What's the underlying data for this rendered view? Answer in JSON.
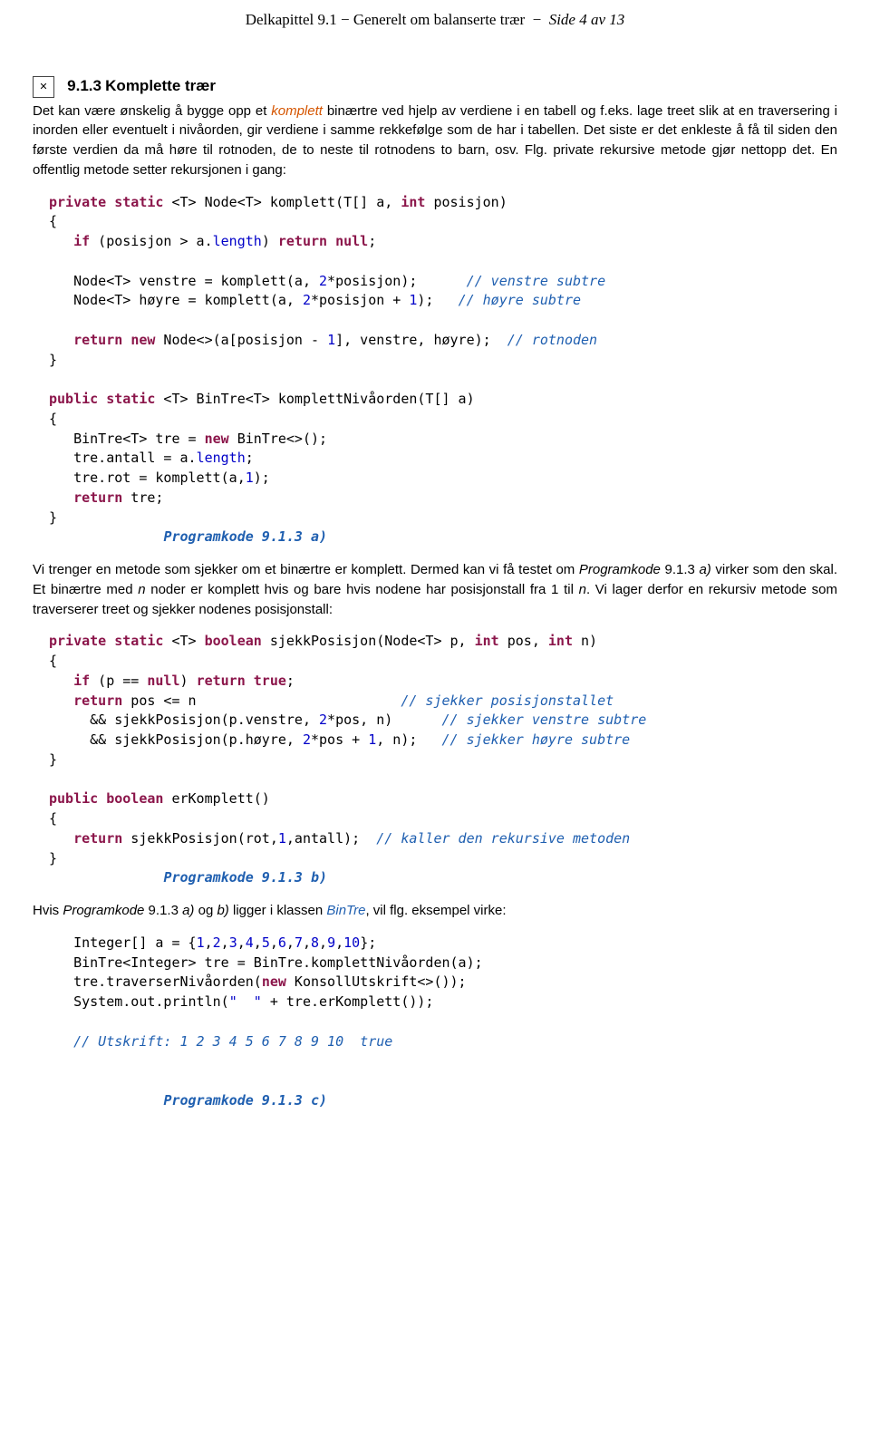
{
  "header": {
    "chapter": "Delkapittel 9.1 − Generelt om balanserte trær",
    "page": "Side 4 av 13"
  },
  "section": {
    "icon": "✕",
    "number": "9.1.3",
    "title": "Komplette trær"
  },
  "intro": {
    "p1a": "Det kan være ønskelig å bygge opp et ",
    "p1_em": "komplett",
    "p1b": " binærtre ved hjelp av verdiene i en tabell og f.eks. lage treet slik at en traversering i inorden eller eventuelt i nivåorden, gir verdiene i samme rekkefølge som de har i tabellen. Det siste er det enkleste å få til siden den første verdien da må høre til rotnoden, de to neste til rotnodens to barn, osv. Flg. private rekursive metode gjør nettopp det. En offentlig metode setter rekursjonen i gang:"
  },
  "code_a": {
    "kw_private": "private",
    "kw_static": "static",
    "kw_int": "int",
    "kw_if": "if",
    "kw_return": "return",
    "kw_null": "null",
    "kw_new": "new",
    "kw_public": "public",
    "sig1_a": " <T> Node<T> komplett(T[] a, ",
    "sig1_b": " posisjon)",
    "brace_open": "{",
    "brace_close": "}",
    "line_if_a": "   ",
    "line_if_b": " (posisjon > a.",
    "length": "length",
    "paren_space": ") ",
    "semi": ";",
    "venstre_a": "   Node<T> venstre = komplett(a, ",
    "two": "2",
    "star_pos": "*posisjon);",
    "cmt_venstre": "// venstre subtre",
    "hoyre_a": "   Node<T> høyre = komplett(a, ",
    "star_pos_plus1": "*posisjon + ",
    "one": "1",
    "paren_semi": ");",
    "cmt_hoyre": "// høyre subtre",
    "ret_node_a": " Node<>(a[posisjon - ",
    "ret_node_b": "], venstre, høyre); ",
    "cmt_rot": "// rotnoden",
    "sig2": " <T> BinTre<T> komplettNivåorden(T[] a)",
    "tre_decl_a": "   BinTre<T> tre = ",
    "tre_decl_b": " BinTre<>();",
    "antall": "   tre.antall = a.",
    "rot_a": "   tre.rot = komplett(a,",
    "return_tre": " tre;",
    "caption_a": "Programkode 9.1.3 a)"
  },
  "mid": {
    "p2a": "Vi trenger en metode som sjekker om et binærtre er komplett. Dermed kan vi få testet om ",
    "p2_ref": "Programkode",
    "p2_refnum": " 9.1.3 ",
    "p2_refletter": "a)",
    "p2b": " virker som den skal. Et binærtre med ",
    "p2_n": "n",
    "p2c": " noder er komplett hvis og bare hvis nodene har posisjonstall fra 1 til ",
    "p2d": ". Vi lager derfor en rekursiv metode som traverserer treet og sjekker nodenes posisjonstall:"
  },
  "code_b": {
    "kw_boolean": "boolean",
    "kw_true": "true",
    "sig3_a": " <T> ",
    "sig3_b": " sjekkPosisjon(Node<T> p, ",
    "sig3_c": " pos, ",
    "sig3_d": " n)",
    "ifp_a": " (p == ",
    "retpos": " pos <= n",
    "cmt_pos": "// sjekker posisjonstallet",
    "and_v": "     && sjekkPosisjon(p.venstre, ",
    "pos_n": "*pos, n)",
    "cmt_sv": "// sjekker venstre subtre",
    "and_h": "     && sjekkPosisjon(p.høyre, ",
    "pos_p1_n": "*pos + ",
    "comma_n": ", n);",
    "cmt_sh": "// sjekker høyre subtre",
    "sig4_a": " erKomplett()",
    "ret4": " sjekkPosisjon(rot,",
    "comma_antall": ",antall); ",
    "cmt_kaller": "// kaller den rekursive metoden",
    "caption_b": "Programkode 9.1.3 b)"
  },
  "hvis": {
    "p3a": "Hvis ",
    "p3_ref": "Programkode",
    "p3_num": " 9.1.3 ",
    "p3_a": "a)",
    "p3_og": " og ",
    "p3_b": "b)",
    "p3_lig": " ligger i klassen ",
    "p3_bin": "BinTre",
    "p3_rest": ", vil flg. eksempel virke:"
  },
  "code_c": {
    "ints": "   Integer[] a = {",
    "n1": "1",
    "n2": "2",
    "n3": "3",
    "n4": "4",
    "n5": "5",
    "n6": "6",
    "n7": "7",
    "n8": "8",
    "n9": "9",
    "n10": "10",
    "closebrace": "};",
    "line2": "   BinTre<Integer> tre = BinTre.komplettNivåorden(a);",
    "line3a": "   tre.traverserNivåorden(",
    "line3b": " KonsollUtskrift<>());",
    "line4a": "   System.out.println(",
    "spaces_lit": "\"  \"",
    "line4b": " + tre.erKomplett());",
    "utskrift": "// Utskrift: 1 2 3 4 5 6 7 8 9 10  true",
    "caption_c": "Programkode 9.1.3 c)",
    "comma": ","
  }
}
